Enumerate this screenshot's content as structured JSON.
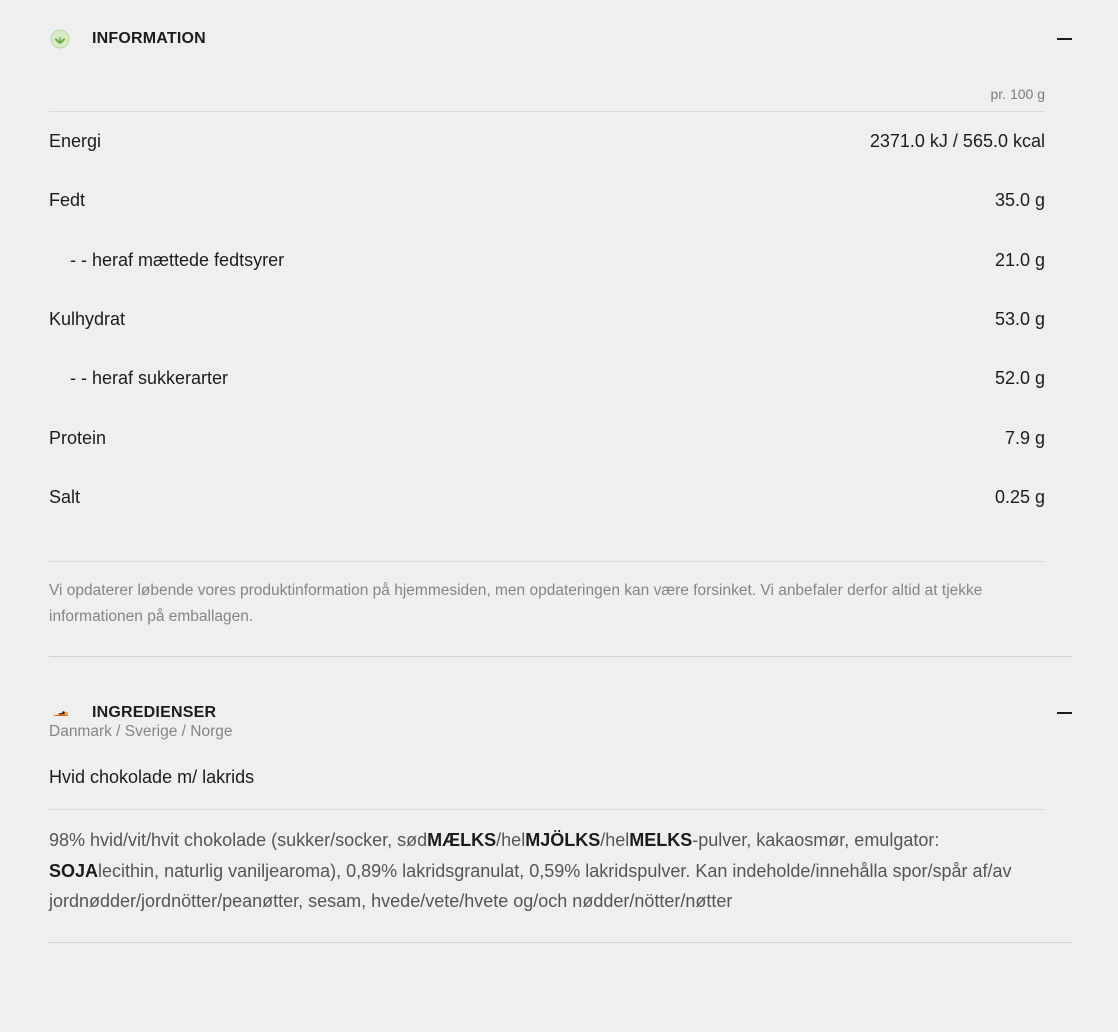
{
  "information": {
    "title": "INFORMATION",
    "per_label": "pr. 100 g",
    "rows": [
      {
        "label": "Energi",
        "value": "2371.0 kJ / 565.0 kcal",
        "sub": false
      },
      {
        "label": "Fedt",
        "value": "35.0 g",
        "sub": false
      },
      {
        "label": "- - heraf mættede fedtsyrer",
        "value": "21.0 g",
        "sub": true
      },
      {
        "label": "Kulhydrat",
        "value": "53.0 g",
        "sub": false
      },
      {
        "label": "- - heraf sukkerarter",
        "value": "52.0 g",
        "sub": true
      },
      {
        "label": "Protein",
        "value": "7.9 g",
        "sub": false
      },
      {
        "label": "Salt",
        "value": "0.25 g",
        "sub": false
      }
    ],
    "disclaimer": "Vi opdaterer løbende vores produktinformation på hjemmesiden, men opdateringen kan være forsinket. Vi anbefaler derfor altid at tjekke informationen på emballagen."
  },
  "ingredients": {
    "title": "INGREDIENSER",
    "region": "Danmark / Sverige / Norge",
    "product": "Hvid chokolade m/ lakrids",
    "text_parts": [
      {
        "text": "98% hvid/vit/hvit chokolade (sukker/socker, sød",
        "bold": false
      },
      {
        "text": "MÆLKS",
        "bold": true
      },
      {
        "text": "/hel",
        "bold": false
      },
      {
        "text": "MJÖLKS",
        "bold": true
      },
      {
        "text": "/hel",
        "bold": false
      },
      {
        "text": "MELKS",
        "bold": true
      },
      {
        "text": "-pulver, kakaosmør, emulgator: ",
        "bold": false
      },
      {
        "text": "SOJA",
        "bold": true
      },
      {
        "text": "lecithin, naturlig vaniljearoma), 0,89% lakridsgranulat, 0,59% lakridspulver. Kan indeholde/innehålla spor/spår af/av jordnødder/jordnötter/peanøtter, sesam, hvede/vete/hvete og/och nødder/nötter/nøtter",
        "bold": false
      }
    ]
  },
  "icons": {
    "information": "leaf-badge-icon",
    "ingredients": "ingredients-icon",
    "collapse": "minus-icon"
  },
  "colors": {
    "background": "#efefef",
    "text": "#1c1c1c",
    "muted": "#858585",
    "leaf_green": "#6fb544"
  }
}
